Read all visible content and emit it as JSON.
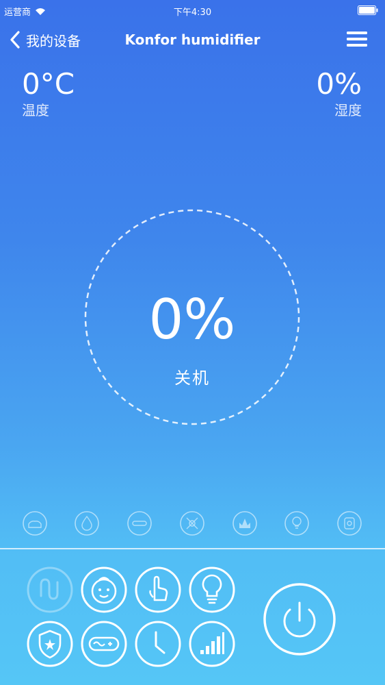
{
  "status_bar": {
    "carrier": "运营商",
    "time": "下午4:30"
  },
  "nav": {
    "back_label": "我的设备",
    "title": "Konfor humidifier"
  },
  "temperature": {
    "value": "0°C",
    "label": "温度"
  },
  "humidity": {
    "value": "0%",
    "label": "湿度"
  },
  "dial": {
    "value": "0%",
    "status": "关机"
  },
  "mode_icons": [
    "sleep-icon",
    "water-drop-icon",
    "minus-icon",
    "fan-icon",
    "plant-icon",
    "bulb-small-icon",
    "timer-small-icon"
  ],
  "controls": [
    "intelligent-icon",
    "baby-icon",
    "manual-icon",
    "light-icon",
    "shield-icon",
    "capsule-icon",
    "clock-icon",
    "level-icon"
  ],
  "power_icon": "power-icon"
}
